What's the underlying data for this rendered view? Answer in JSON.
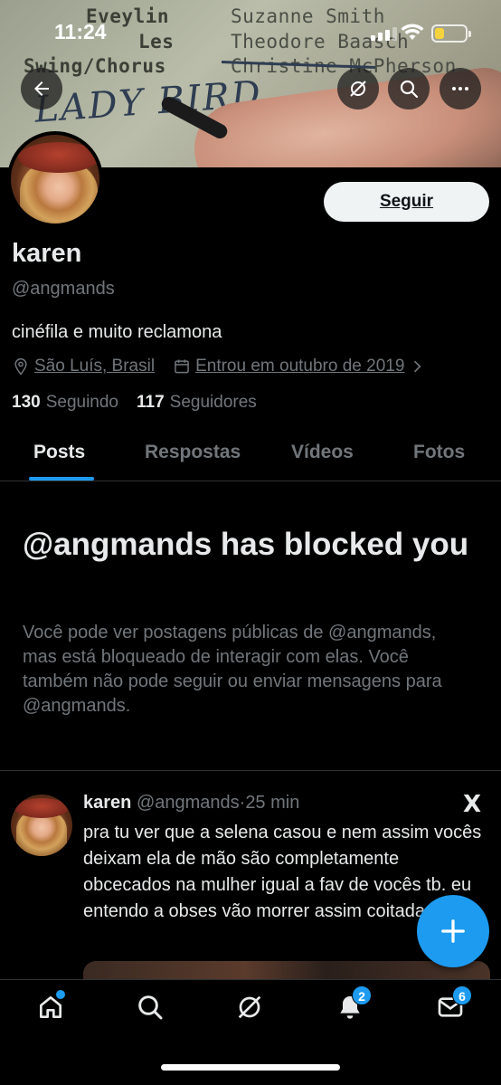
{
  "status_bar": {
    "time": "11:24"
  },
  "banner": {
    "paper_lines_left": [
      "Eveylin",
      "Les",
      "Swing/Chorus"
    ],
    "paper_lines_right": [
      "Suzanne Smith",
      "Theodore Baasch",
      "Christine McPherson"
    ],
    "handwriting": "LADY BIRD",
    "controls": {
      "back_icon": "arrow-left-icon",
      "grok_icon": "grok-icon",
      "search_icon": "search-icon",
      "more_icon": "more-icon"
    }
  },
  "profile": {
    "follow_label": "Seguir",
    "display_name": "karen",
    "handle": "@angmands",
    "bio": "cinéfila e muito reclamona",
    "location": "São Luís, Brasil",
    "joined": "Entrou em outubro de 2019",
    "following_count": "130",
    "following_label": "Seguindo",
    "followers_count": "117",
    "followers_label": "Seguidores"
  },
  "tabs": [
    {
      "label": "Posts",
      "active": true
    },
    {
      "label": "Respostas",
      "active": false
    },
    {
      "label": "Vídeos",
      "active": false
    },
    {
      "label": "Fotos",
      "active": false
    }
  ],
  "blocked": {
    "title": "@angmands has blocked you",
    "body": "Você pode ver postagens públicas de @angmands, mas está bloqueado de interagir com elas. Você também não pode seguir ou enviar mensagens para @angmands."
  },
  "tweet": {
    "name": "karen",
    "handle": "@angmands",
    "separator": "·",
    "time": "25 min",
    "text": "pra tu ver que a selena casou e nem assim vocês deixam ela de mão são completamente obcecados na mulher igual a fav de vocês tb. eu entendo a obses vão morrer assim coitadas",
    "source_logo": "X"
  },
  "fab": {
    "icon": "plus-icon"
  },
  "bottom_nav": {
    "notifications_badge": "2",
    "messages_badge": "6"
  },
  "colors": {
    "accent": "#1d9bf0",
    "background": "#000000",
    "text_primary": "#e7e9ea",
    "text_secondary": "#71767b",
    "divider": "#2f3336",
    "battery": "#f5d33d"
  }
}
